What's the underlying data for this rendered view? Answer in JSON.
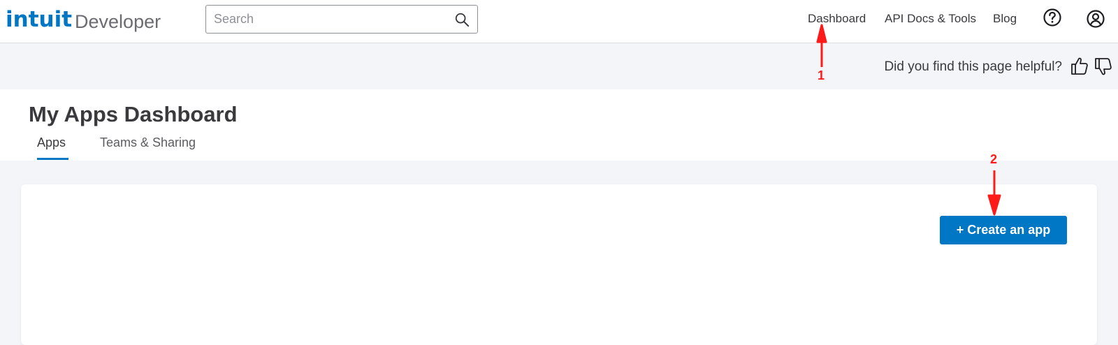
{
  "header": {
    "logo_brand": "intuit",
    "logo_product": "Developer",
    "search": {
      "placeholder": "Search",
      "value": ""
    },
    "nav": [
      "Dashboard",
      "API Docs & Tools",
      "Blog"
    ],
    "icons": [
      "search-icon",
      "help-icon",
      "account-icon"
    ]
  },
  "feedback": {
    "question": "Did you find this page helpful?",
    "icons": [
      "thumbs-up-icon",
      "thumbs-down-icon"
    ]
  },
  "page": {
    "title": "My Apps Dashboard",
    "tabs": [
      {
        "label": "Apps",
        "active": true
      },
      {
        "label": "Teams & Sharing",
        "active": false
      }
    ]
  },
  "card": {
    "create_button": "+ Create an app"
  },
  "annotations": [
    {
      "number": "1"
    },
    {
      "number": "2"
    }
  ],
  "colors": {
    "brand": "#0077c5",
    "annotation": "#ff1a1a",
    "background": "#f4f5f8"
  }
}
